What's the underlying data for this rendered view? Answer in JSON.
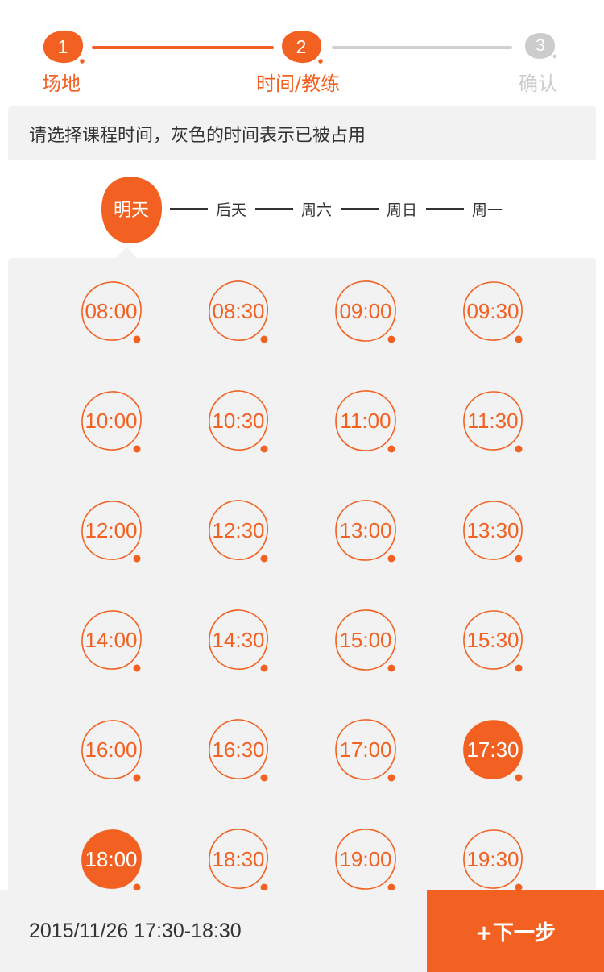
{
  "colors": {
    "accent": "#f26122",
    "inactive": "#cccccc",
    "panel": "#f2f2f2"
  },
  "stepper": {
    "steps": [
      {
        "number": "1",
        "label": "场地",
        "state": "done"
      },
      {
        "number": "2",
        "label": "时间/教练",
        "state": "active"
      },
      {
        "number": "3",
        "label": "确认",
        "state": "pending"
      }
    ]
  },
  "hint": "请选择课程时间，灰色的时间表示已被占用",
  "days": [
    {
      "label": "明天",
      "selected": true
    },
    {
      "label": "后天",
      "selected": false
    },
    {
      "label": "周六",
      "selected": false
    },
    {
      "label": "周日",
      "selected": false
    },
    {
      "label": "周一",
      "selected": false
    }
  ],
  "time_slots": [
    {
      "time": "08:00",
      "selected": false
    },
    {
      "time": "08:30",
      "selected": false
    },
    {
      "time": "09:00",
      "selected": false
    },
    {
      "time": "09:30",
      "selected": false
    },
    {
      "time": "10:00",
      "selected": false
    },
    {
      "time": "10:30",
      "selected": false
    },
    {
      "time": "11:00",
      "selected": false
    },
    {
      "time": "11:30",
      "selected": false
    },
    {
      "time": "12:00",
      "selected": false
    },
    {
      "time": "12:30",
      "selected": false
    },
    {
      "time": "13:00",
      "selected": false
    },
    {
      "time": "13:30",
      "selected": false
    },
    {
      "time": "14:00",
      "selected": false
    },
    {
      "time": "14:30",
      "selected": false
    },
    {
      "time": "15:00",
      "selected": false
    },
    {
      "time": "15:30",
      "selected": false
    },
    {
      "time": "16:00",
      "selected": false
    },
    {
      "time": "16:30",
      "selected": false
    },
    {
      "time": "17:00",
      "selected": false
    },
    {
      "time": "17:30",
      "selected": true
    },
    {
      "time": "18:00",
      "selected": true
    },
    {
      "time": "18:30",
      "selected": false
    },
    {
      "time": "19:00",
      "selected": false
    },
    {
      "time": "19:30",
      "selected": false
    }
  ],
  "bottom_bar": {
    "summary": "2015/11/26 17:30-18:30",
    "next_label": "+下一步"
  }
}
